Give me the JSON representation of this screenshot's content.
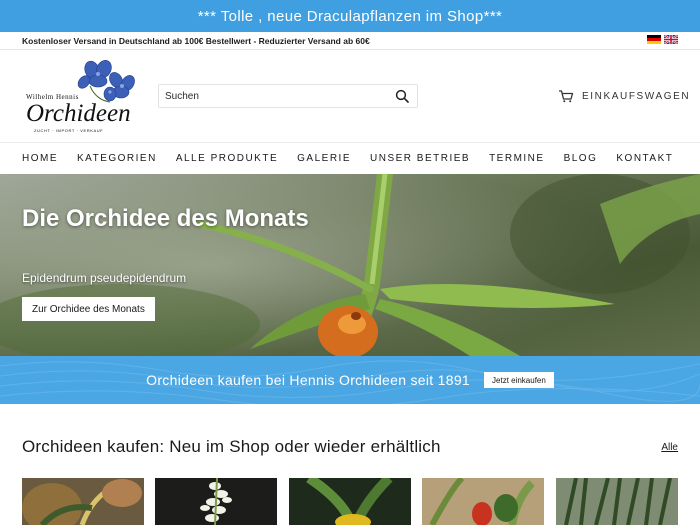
{
  "announcement": {
    "text": "*** Tolle , neue Draculapflanzen im Shop***",
    "bg_color": "#3f9fe0"
  },
  "topbar": {
    "shipping_text": "Kostenloser Versand in Deutschland ab 100€ Bestellwert - Reduzierter Versand ab 60€"
  },
  "logo": {
    "line1": "Wilhelm Hennis",
    "line2": "Orchideen",
    "tagline": "ZUCHT · IMPORT · VERKAUF"
  },
  "search": {
    "placeholder": "Suchen",
    "icon": "search-icon"
  },
  "cart": {
    "label": "EINKAUFSWAGEN",
    "icon": "cart-icon"
  },
  "nav": {
    "items": [
      "HOME",
      "KATEGORIEN",
      "ALLE PRODUKTE",
      "GALERIE",
      "UNSER BETRIEB",
      "TERMINE",
      "BLOG",
      "KONTAKT"
    ]
  },
  "hero": {
    "title": "Die Orchidee des Monats",
    "subtitle": "Epidendrum pseudepidendrum",
    "button": "Zur Orchidee des Monats"
  },
  "band": {
    "text": "Orchideen kaufen bei Hennis Orchideen seit 1891",
    "button": "Jetzt einkaufen",
    "bg_color": "#4ba7e4"
  },
  "products_section": {
    "title": "Orchideen kaufen: Neu im Shop oder wieder erhältlich",
    "all_link": "Alle"
  }
}
